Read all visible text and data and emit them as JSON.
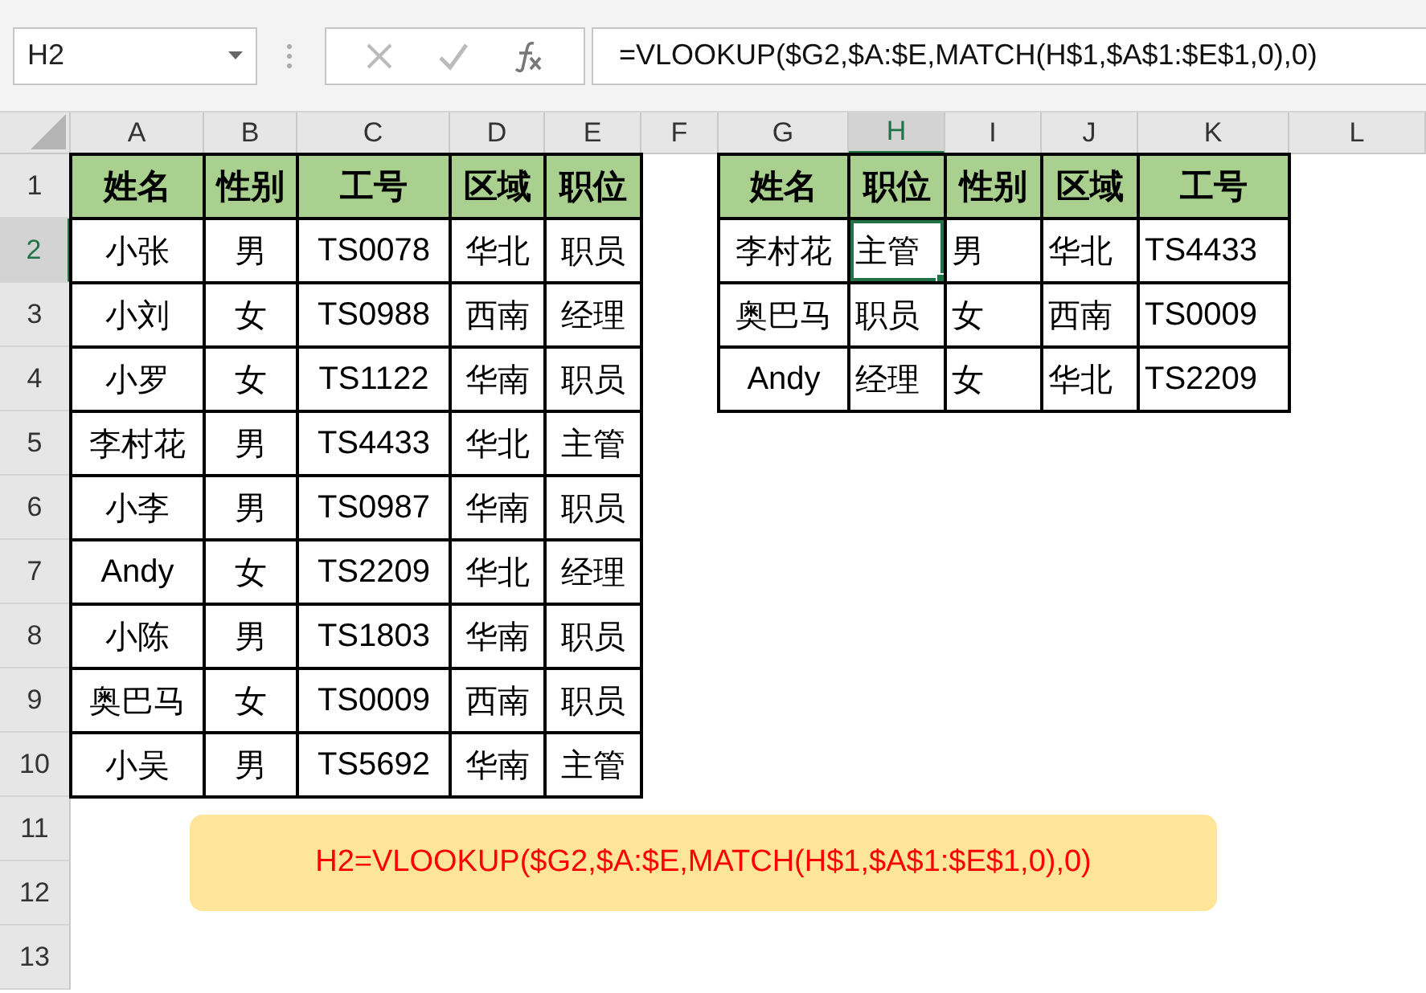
{
  "name_box": {
    "value": "H2"
  },
  "formula_bar": {
    "value": "=VLOOKUP($G2,$A:$E,MATCH(H$1,$A$1:$E$1,0),0)"
  },
  "column_headers": [
    {
      "label": "A",
      "selected": false
    },
    {
      "label": "B",
      "selected": false
    },
    {
      "label": "C",
      "selected": false
    },
    {
      "label": "D",
      "selected": false
    },
    {
      "label": "E",
      "selected": false
    },
    {
      "label": "F",
      "selected": false
    },
    {
      "label": "G",
      "selected": false
    },
    {
      "label": "H",
      "selected": true
    },
    {
      "label": "I",
      "selected": false
    },
    {
      "label": "J",
      "selected": false
    },
    {
      "label": "K",
      "selected": false
    },
    {
      "label": "L",
      "selected": false
    }
  ],
  "row_headers": [
    {
      "label": "1",
      "selected": false
    },
    {
      "label": "2",
      "selected": true
    },
    {
      "label": "3",
      "selected": false
    },
    {
      "label": "4",
      "selected": false
    },
    {
      "label": "5",
      "selected": false
    },
    {
      "label": "6",
      "selected": false
    },
    {
      "label": "7",
      "selected": false
    },
    {
      "label": "8",
      "selected": false
    },
    {
      "label": "9",
      "selected": false
    },
    {
      "label": "10",
      "selected": false
    },
    {
      "label": "11",
      "selected": false
    },
    {
      "label": "12",
      "selected": false
    },
    {
      "label": "13",
      "selected": false
    }
  ],
  "left_table": {
    "header": [
      "姓名",
      "性别",
      "工号",
      "区域",
      "职位"
    ],
    "rows": [
      [
        "小张",
        "男",
        "TS0078",
        "华北",
        "职员"
      ],
      [
        "小刘",
        "女",
        "TS0988",
        "西南",
        "经理"
      ],
      [
        "小罗",
        "女",
        "TS1122",
        "华南",
        "职员"
      ],
      [
        "李村花",
        "男",
        "TS4433",
        "华北",
        "主管"
      ],
      [
        "小李",
        "男",
        "TS0987",
        "华南",
        "职员"
      ],
      [
        "Andy",
        "女",
        "TS2209",
        "华北",
        "经理"
      ],
      [
        "小陈",
        "男",
        "TS1803",
        "华南",
        "职员"
      ],
      [
        "奥巴马",
        "女",
        "TS0009",
        "西南",
        "职员"
      ],
      [
        "小吴",
        "男",
        "TS5692",
        "华南",
        "主管"
      ]
    ]
  },
  "right_table": {
    "header": [
      "姓名",
      "职位",
      "性别",
      "区域",
      "工号"
    ],
    "rows": [
      [
        {
          "text": "李村花",
          "selected": false
        },
        {
          "text": "主管",
          "selected": true
        },
        {
          "text": "男",
          "selected": false
        },
        {
          "text": "华北",
          "selected": false
        },
        {
          "text": "TS4433",
          "selected": false
        }
      ],
      [
        {
          "text": "奥巴马",
          "selected": false
        },
        {
          "text": "职员",
          "selected": false
        },
        {
          "text": "女",
          "selected": false
        },
        {
          "text": "西南",
          "selected": false
        },
        {
          "text": "TS0009",
          "selected": false
        }
      ],
      [
        {
          "text": "Andy",
          "selected": false
        },
        {
          "text": "经理",
          "selected": false
        },
        {
          "text": "女",
          "selected": false
        },
        {
          "text": "华北",
          "selected": false
        },
        {
          "text": "TS2209",
          "selected": false
        }
      ]
    ]
  },
  "note": "H2=VLOOKUP($G2,$A:$E,MATCH(H$1,$A$1:$E$1,0),0)"
}
